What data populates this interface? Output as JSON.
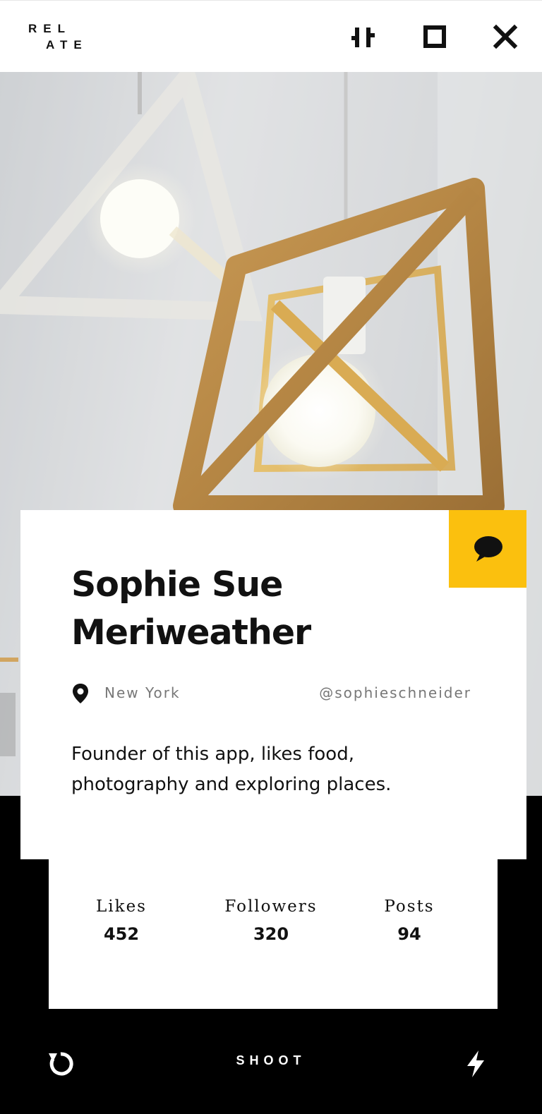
{
  "app": {
    "logo_line1": "REL",
    "logo_line2": "ATE"
  },
  "header": {
    "icons": [
      "adjust-icon",
      "square-icon",
      "close-icon"
    ]
  },
  "profile": {
    "name": "Sophie Sue Meriweather",
    "location": "New York",
    "handle": "@sophieschneider",
    "bio": "Founder of this app, likes food, photography and exploring places."
  },
  "stats": [
    {
      "label": "Likes",
      "value": "452"
    },
    {
      "label": "Followers",
      "value": "320"
    },
    {
      "label": "Posts",
      "value": "94"
    }
  ],
  "bottom_bar": {
    "shoot_label": "SHOOT",
    "left_icon": "refresh-icon",
    "right_icon": "flash-icon"
  },
  "colors": {
    "accent": "#fbc00e",
    "background": "#000000",
    "card": "#ffffff"
  }
}
